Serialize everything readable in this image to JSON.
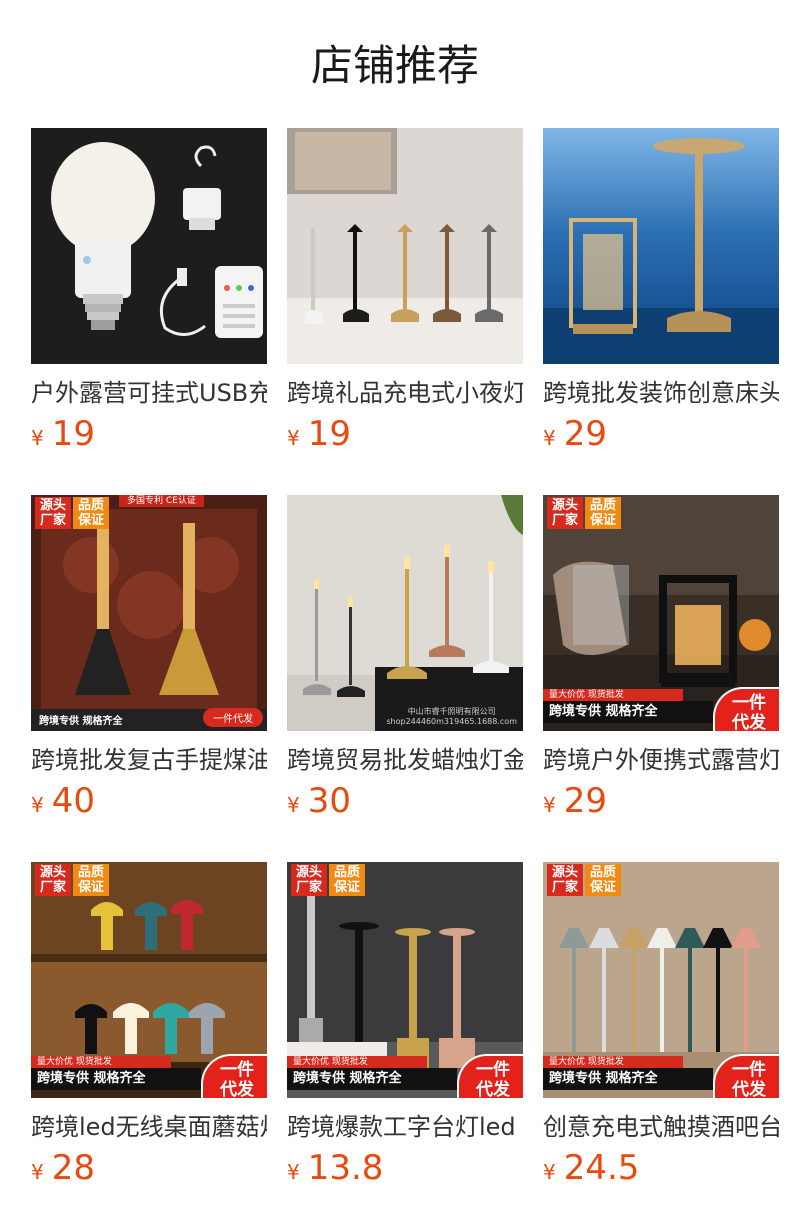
{
  "header": {
    "title": "店铺推荐"
  },
  "currency_symbol": "¥",
  "products": [
    {
      "name": "户外露营可挂式USB充电",
      "price": "19"
    },
    {
      "name": "跨境礼品充电式小夜灯",
      "price": "19"
    },
    {
      "name": "跨境批发装饰创意床头",
      "price": "29"
    },
    {
      "name": "跨境批发复古手提煤油",
      "price": "40"
    },
    {
      "name": "跨境贸易批发蜡烛灯金",
      "price": "30"
    },
    {
      "name": "跨境户外便携式露营灯",
      "price": "29"
    },
    {
      "name": "跨境led无线桌面蘑菇灯",
      "price": "28"
    },
    {
      "name": "跨境爆款工字台灯led",
      "price": "13.8"
    },
    {
      "name": "创意充电式触摸酒吧台",
      "price": "24.5"
    }
  ],
  "overlays": {
    "badge_source": "源头\n厂家",
    "badge_quality": "品质\n保证",
    "banner_text": "跨境专供 规格齐全",
    "red_tag_text": "量大价优   现货批发",
    "oval_text": "一件\n代发",
    "top_strip_text": "多国专利   CE认证",
    "pill_text": "一件代发",
    "watermark_line1": "中山市睿千照明有限公司",
    "watermark_line2": "shop244460m319465.1688.com"
  }
}
